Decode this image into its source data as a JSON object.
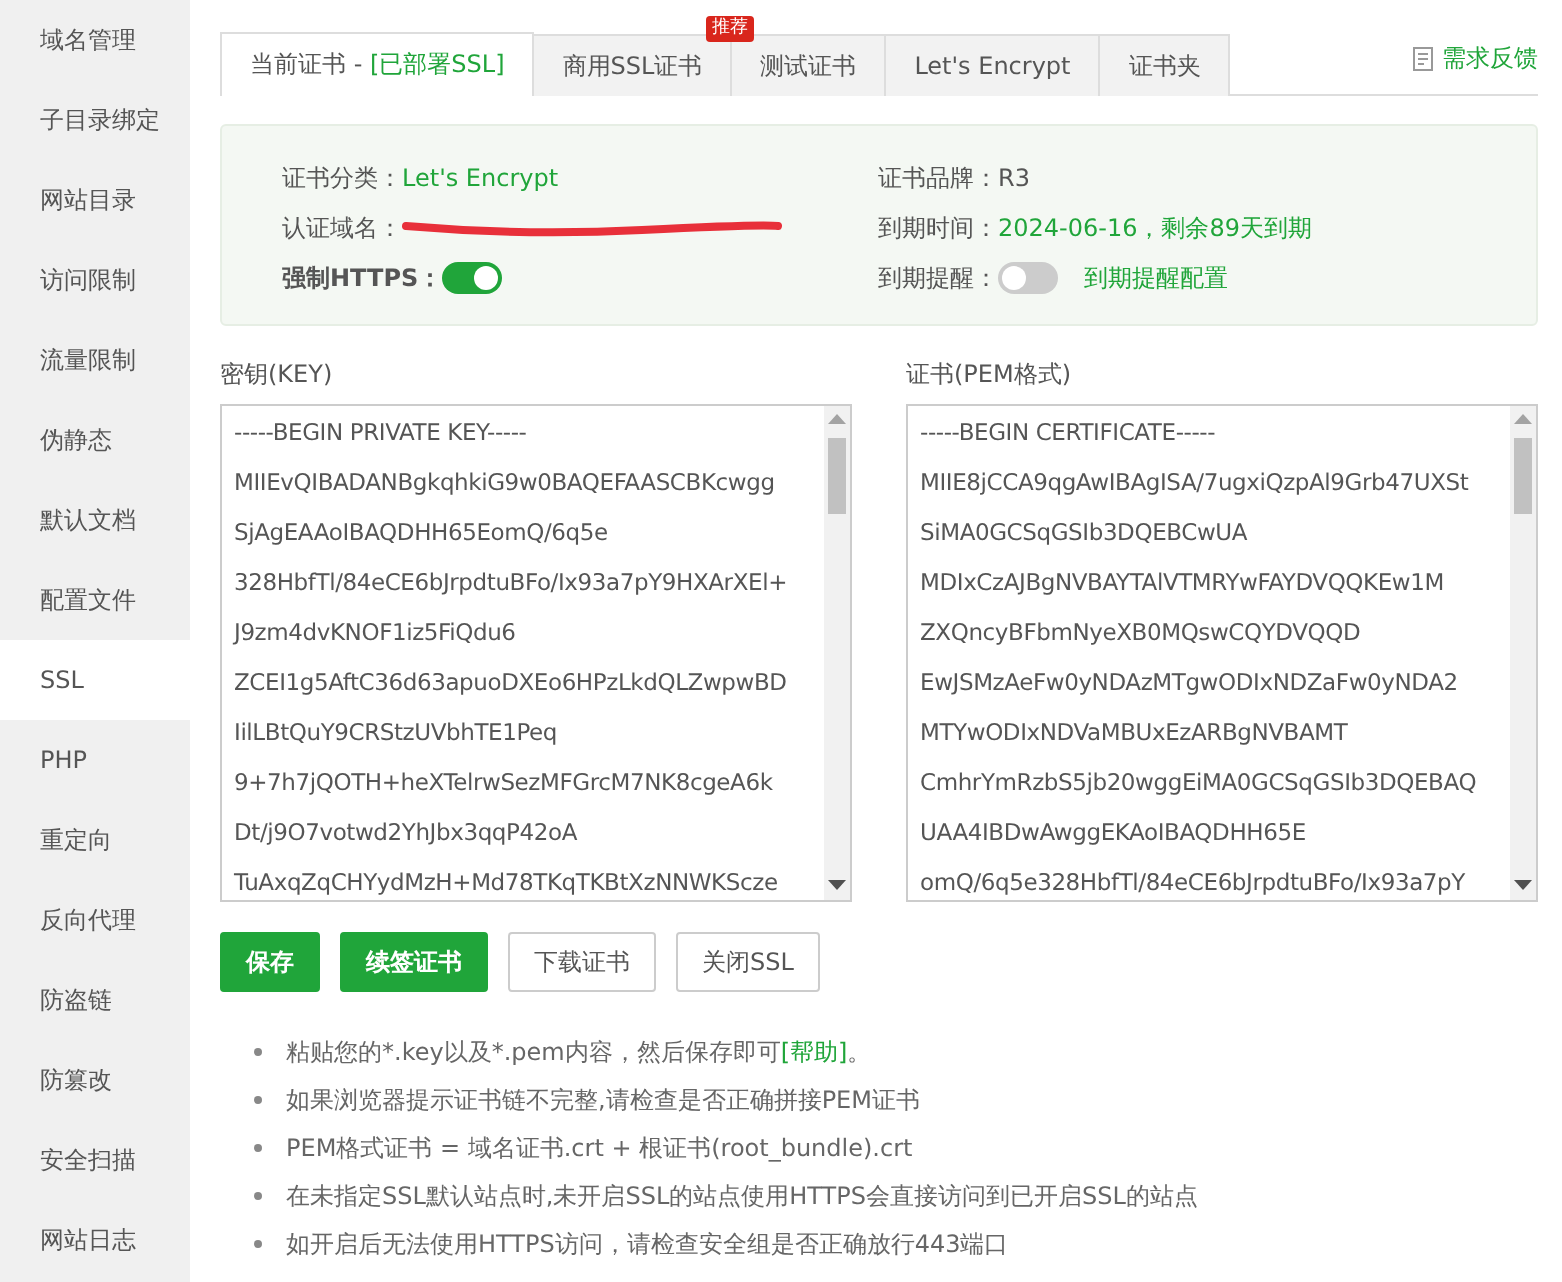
{
  "sidebar": {
    "items": [
      {
        "label": "域名管理",
        "selected": false
      },
      {
        "label": "子目录绑定",
        "selected": false
      },
      {
        "label": "网站目录",
        "selected": false
      },
      {
        "label": "访问限制",
        "selected": false
      },
      {
        "label": "流量限制",
        "selected": false
      },
      {
        "label": "伪静态",
        "selected": false
      },
      {
        "label": "默认文档",
        "selected": false
      },
      {
        "label": "配置文件",
        "selected": false
      },
      {
        "label": "SSL",
        "selected": true
      },
      {
        "label": "PHP",
        "selected": false
      },
      {
        "label": "重定向",
        "selected": false
      },
      {
        "label": "反向代理",
        "selected": false
      },
      {
        "label": "防盗链",
        "selected": false
      },
      {
        "label": "防篡改",
        "selected": false
      },
      {
        "label": "安全扫描",
        "selected": false
      },
      {
        "label": "网站日志",
        "selected": false
      }
    ]
  },
  "tabs": [
    {
      "label": "当前证书 - ",
      "status": "[已部署SSL]",
      "selected": true
    },
    {
      "label": "商用SSL证书",
      "badge": "推荐",
      "selected": false
    },
    {
      "label": "测试证书",
      "selected": false
    },
    {
      "label": "Let's Encrypt",
      "selected": false
    },
    {
      "label": "证书夹",
      "selected": false
    }
  ],
  "feedback_link": "需求反馈",
  "info": {
    "category_label": "证书分类：",
    "category": "Let's Encrypt",
    "brand_label": "证书品牌：",
    "brand": "R3",
    "domain_label": "认证域名：",
    "domain_redacted": true,
    "expiry_label": "到期时间：",
    "expiry": "2024-06-16，剩余89天到期",
    "https_label": "强制HTTPS：",
    "force_https": true,
    "reminder_label": "到期提醒：",
    "reminder": false,
    "reminder_link": "到期提醒配置"
  },
  "key": {
    "label": "密钥(KEY)",
    "value": "-----BEGIN PRIVATE KEY-----\nMIIEvQIBADANBgkqhkiG9w0BAQEFAASCBKcwgg\nSjAgEAAoIBAQDHH65EomQ/6q5e\n328HbfTl/84eCE6bJrpdtuBFo/Ix93a7pY9HXArXEl+\nJ9zm4dvKNOF1iz5FiQdu6\nZCEI1g5AftC36d63apuoDXEo6HPzLkdQLZwpwBD\nIilLBtQuY9CRStzUVbhTE1Peq\n9+7h7jQOTH+heXTelrwSezMFGrcM7NK8cgeA6k\nDt/j9O7votwd2YhJbx3qqP42oA\nTuAxqZqCHYydMzH+Md78TKqTKBtXzNNWKScze"
  },
  "cert": {
    "label": "证书(PEM格式)",
    "value": "-----BEGIN CERTIFICATE-----\nMIIE8jCCA9qgAwIBAgISA/7ugxiQzpAl9Grb47UXSt\nSiMA0GCSqGSIb3DQEBCwUA\nMDIxCzAJBgNVBAYTAlVTMRYwFAYDVQQKEw1M\nZXQncyBFbmNyeXB0MQswCQYDVQQD\nEwJSMzAeFw0yNDAzMTgwODIxNDZaFw0yNDA2\nMTYwODIxNDVaMBUxEzARBgNVBAMT\nCmhrYmRzbS5jb20wggEiMA0GCSqGSIb3DQEBAQ\nUAA4IBDwAwggEKAoIBAQDHH65E\nomQ/6q5e328HbfTl/84eCE6bJrpdtuBFo/Ix93a7pY"
  },
  "buttons": [
    {
      "label": "保存",
      "kind": "primary"
    },
    {
      "label": "续签证书",
      "kind": "primary"
    },
    {
      "label": "下载证书",
      "kind": "default"
    },
    {
      "label": "关闭SSL",
      "kind": "default"
    }
  ],
  "notes": [
    {
      "text": "粘贴您的*.key以及*.pem内容，然后保存即可",
      "link": "[帮助]",
      "tail": "。"
    },
    {
      "text": "如果浏览器提示证书链不完整,请检查是否正确拼接PEM证书"
    },
    {
      "text": "PEM格式证书 = 域名证书.crt + 根证书(root_bundle).crt"
    },
    {
      "text": "在未指定SSL默认站点时,未开启SSL的站点使用HTTPS会直接访问到已开启SSL的站点"
    },
    {
      "text": "如开启后无法使用HTTPS访问，请检查安全组是否正确放行443端口"
    }
  ]
}
